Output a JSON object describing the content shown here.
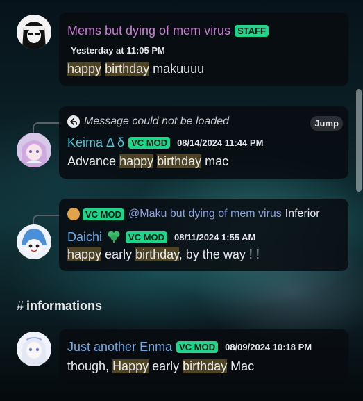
{
  "messages": [
    {
      "author": "Mems but dying of mem virus",
      "author_color": "#c97ed3",
      "badge": "STAFF",
      "timestamp": "Yesterday at 11:05 PM",
      "text_parts": [
        "happy",
        " ",
        "birthday",
        " makuuuu"
      ]
    },
    {
      "reply": {
        "text": "Message could not be loaded",
        "jump_label": "Jump"
      },
      "author": "Keima Δ δ",
      "author_color": "#4fc7d8",
      "badge": "VC MOD",
      "timestamp": "08/14/2024 11:44 PM",
      "text_parts": [
        "Advance ",
        "happy",
        " ",
        "birthday",
        " mac"
      ]
    },
    {
      "reply": {
        "badge": "VC MOD",
        "mention": "@Maku but dying of mem virus",
        "text": "Inferior"
      },
      "author": "Daichi",
      "author_color": "#6ea9e8",
      "badge": "VC MOD",
      "timestamp": "08/11/2024 1:55 AM",
      "text_parts": [
        "happy",
        " early ",
        "birthday",
        ", by the way ! !"
      ]
    },
    {
      "author": "Just another Enma",
      "author_color": "#6ea9e8",
      "badge": "VC MOD",
      "timestamp": "08/09/2024 10:18 PM",
      "text_parts": [
        "though, ",
        "Happy",
        " early ",
        "birthday",
        " Mac"
      ]
    }
  ],
  "channel": {
    "hash": "#",
    "name": "informations"
  },
  "colors": {
    "badge_green": "#1ed48b",
    "highlight": "#4e4424"
  }
}
